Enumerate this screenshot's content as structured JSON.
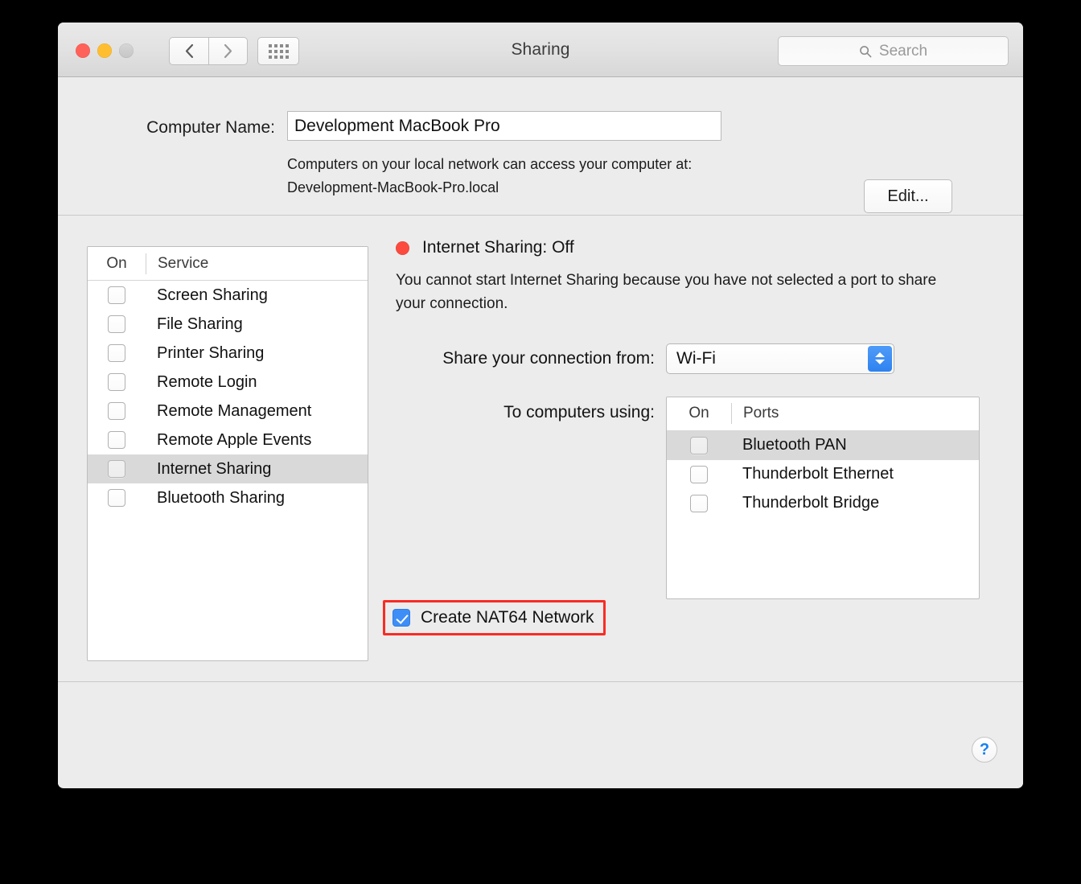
{
  "window": {
    "title": "Sharing",
    "traffic_lights": [
      "close",
      "minimize",
      "zoom"
    ],
    "search": {
      "placeholder": "Search",
      "value": ""
    }
  },
  "computer_name": {
    "label": "Computer Name:",
    "value": "Development MacBook Pro",
    "note_line1": "Computers on your local network can access your computer at:",
    "note_line2": "Development-MacBook-Pro.local",
    "edit_button": "Edit..."
  },
  "services": {
    "header": {
      "on": "On",
      "service": "Service"
    },
    "rows": [
      {
        "label": "Screen Sharing",
        "checked": false,
        "selected": false
      },
      {
        "label": "File Sharing",
        "checked": false,
        "selected": false
      },
      {
        "label": "Printer Sharing",
        "checked": false,
        "selected": false
      },
      {
        "label": "Remote Login",
        "checked": false,
        "selected": false
      },
      {
        "label": "Remote Management",
        "checked": false,
        "selected": false
      },
      {
        "label": "Remote Apple Events",
        "checked": false,
        "selected": false
      },
      {
        "label": "Internet Sharing",
        "checked": false,
        "selected": true
      },
      {
        "label": "Bluetooth Sharing",
        "checked": false,
        "selected": false
      }
    ]
  },
  "detail": {
    "status_text": "Internet Sharing: Off",
    "status_color": "#fc4a3f",
    "status_description": "You cannot start Internet Sharing because you have not selected a port to share your connection.",
    "share_from_label": "Share your connection from:",
    "share_from_value": "Wi-Fi",
    "to_computers_label": "To computers using:",
    "ports_header": {
      "on": "On",
      "ports": "Ports"
    },
    "ports": [
      {
        "label": "Bluetooth PAN",
        "checked": false,
        "selected": true
      },
      {
        "label": "Thunderbolt Ethernet",
        "checked": false,
        "selected": false
      },
      {
        "label": "Thunderbolt Bridge",
        "checked": false,
        "selected": false
      }
    ],
    "nat64": {
      "label": "Create NAT64 Network",
      "checked": true,
      "highlight_color": "#f92c23"
    }
  },
  "footer": {
    "help": "?"
  }
}
